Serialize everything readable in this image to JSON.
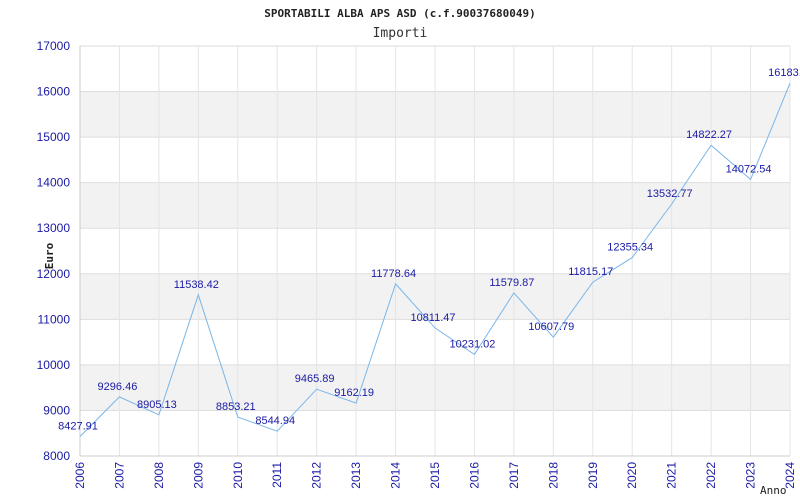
{
  "chart_data": {
    "type": "line",
    "title": "SPORTABILI ALBA APS ASD (c.f.90037680049)",
    "subtitle": "Importi",
    "xlabel": "Anno",
    "ylabel": "Euro",
    "ylim": [
      8000,
      17000
    ],
    "yticks": [
      "8000",
      "9000",
      "10000",
      "11000",
      "12000",
      "13000",
      "14000",
      "15000",
      "16000",
      "17000"
    ],
    "grid": "horizontal alternating bands",
    "colors": {
      "line": "#7ab6ea",
      "tick_text": "#1a1aa6",
      "band": "#f2f2f2"
    },
    "categories": [
      "2006",
      "2007",
      "2008",
      "2009",
      "2010",
      "2011",
      "2012",
      "2013",
      "2014",
      "2015",
      "2016",
      "2017",
      "2018",
      "2019",
      "2020",
      "2021",
      "2022",
      "2023",
      "2024"
    ],
    "series": [
      {
        "values": [
          8427.91,
          9296.46,
          8905.13,
          11538.42,
          8853.21,
          8544.94,
          9465.89,
          9162.19,
          11778.64,
          10811.47,
          10231.02,
          11579.87,
          10607.79,
          11815.17,
          12355.34,
          13532.77,
          14822.27,
          14072.54,
          16183.4
        ],
        "labels": [
          "8427.91",
          "9296.46",
          "8905.13",
          "11538.42",
          "8853.21",
          "8544.94",
          "9465.89",
          "9162.19",
          "11778.64",
          "10811.47",
          "10231.02",
          "11579.87",
          "10607.79",
          "11815.17",
          "12355.34",
          "13532.77",
          "14822.27",
          "14072.54",
          "16183.4"
        ]
      }
    ]
  }
}
